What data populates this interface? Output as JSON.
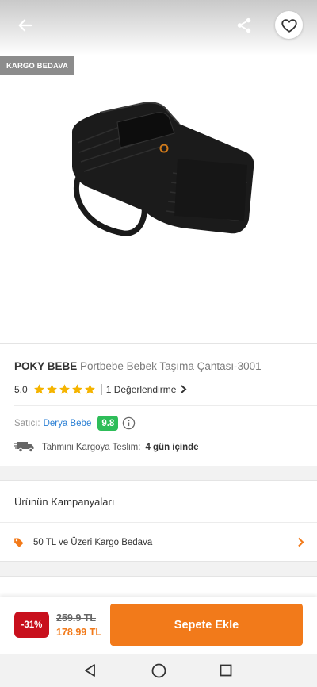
{
  "hero": {
    "cargo_badge": "KARGO BEDAVA"
  },
  "icons": {
    "back": "back-arrow-icon",
    "share": "share-icon",
    "favorite": "heart-outline-icon",
    "info": "info-circle-icon",
    "truck": "truck-icon",
    "tag": "tag-icon"
  },
  "product": {
    "brand": "POKY BEBE",
    "name": "Portbebe Bebek Taşıma Çantası-3001",
    "rating": "5.0",
    "stars": 5,
    "reviews": "1 Değerlendirme"
  },
  "seller": {
    "label": "Satıcı:",
    "name": "Derya Bebe",
    "score": "9.8"
  },
  "shipping": {
    "label": "Tahmini Kargoya Teslim:",
    "value": "4 gün içinde"
  },
  "campaigns": {
    "title": "Ürünün Kampanyaları",
    "item": "50 TL ve Üzeri Kargo Bedava"
  },
  "buybar": {
    "discount": "-31%",
    "old_price": "259.9 TL",
    "new_price": "178.99 TL",
    "cart_label": "Sepete Ekle"
  },
  "colors": {
    "accent": "#f27a1a",
    "discount": "#c8101d",
    "score": "#2ebd59",
    "star": "#f5b400",
    "link": "#2a7fd4"
  }
}
